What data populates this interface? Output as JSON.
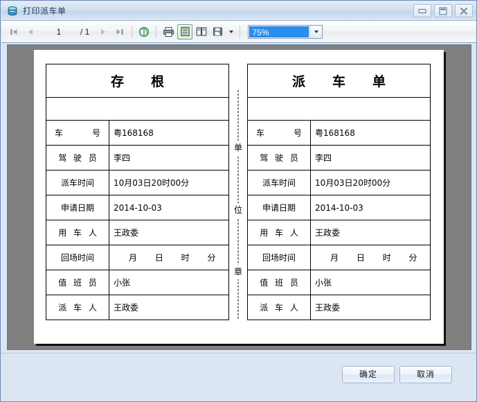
{
  "window": {
    "title": "打印派车单",
    "icon": "report-icon",
    "controls": {
      "minimize": "minimize-icon",
      "maximize": "maximize-icon",
      "close": "close-icon"
    }
  },
  "toolbar": {
    "first_page": "first-page-icon",
    "prev_page": "previous-page-icon",
    "page_value": "1",
    "page_total": "/ 1",
    "next_page": "next-page-icon",
    "last_page": "last-page-icon",
    "refresh": "refresh-icon",
    "print": "print-icon",
    "single_page_view": "single-page-view-icon",
    "two_page_view": "two-page-view-icon",
    "export": "export-save-icon",
    "export_dropdown": "chevron-down-icon",
    "zoom_value": "75%",
    "zoom_dropdown": "chevron-down-icon"
  },
  "document": {
    "seal_text": [
      "单",
      "位",
      "章"
    ],
    "forms": [
      {
        "title": "存　根",
        "rows": [
          {
            "label": "车　　号",
            "value": "粤168168",
            "spread": false
          },
          {
            "label": "驾 驶 员",
            "value": "李四",
            "spread": false
          },
          {
            "label": "派车时间",
            "value": "10月03日20时00分",
            "spread": false
          },
          {
            "label": "申请日期",
            "value": "2014-10-03",
            "spread": false
          },
          {
            "label": "用 车 人",
            "value": "王政委",
            "spread": false
          },
          {
            "label": "回场时间",
            "value": "月 日 时 分",
            "spread": true
          },
          {
            "label": "值 班 员",
            "value": "小张",
            "spread": false
          },
          {
            "label": "派 车 人",
            "value": "王政委",
            "spread": false
          }
        ]
      },
      {
        "title": "派　车　单",
        "rows": [
          {
            "label": "车　　号",
            "value": "粤168168",
            "spread": false
          },
          {
            "label": "驾 驶 员",
            "value": "李四",
            "spread": false
          },
          {
            "label": "派车时间",
            "value": "10月03日20时00分",
            "spread": false
          },
          {
            "label": "申请日期",
            "value": "2014-10-03",
            "spread": false
          },
          {
            "label": "用 车 人",
            "value": "王政委",
            "spread": false
          },
          {
            "label": "回场时间",
            "value": "月 日 时 分",
            "spread": true
          },
          {
            "label": "值 班 员",
            "value": "小张",
            "spread": false
          },
          {
            "label": "派 车 人",
            "value": "王政委",
            "spread": false
          }
        ]
      }
    ]
  },
  "footer": {
    "ok_label": "确定",
    "cancel_label": "取消"
  },
  "colors": {
    "window_chrome": "#dce6f2",
    "preview_background": "#808080",
    "zoom_highlight": "#2a8ef0",
    "title_text": "#1b3a5c"
  }
}
